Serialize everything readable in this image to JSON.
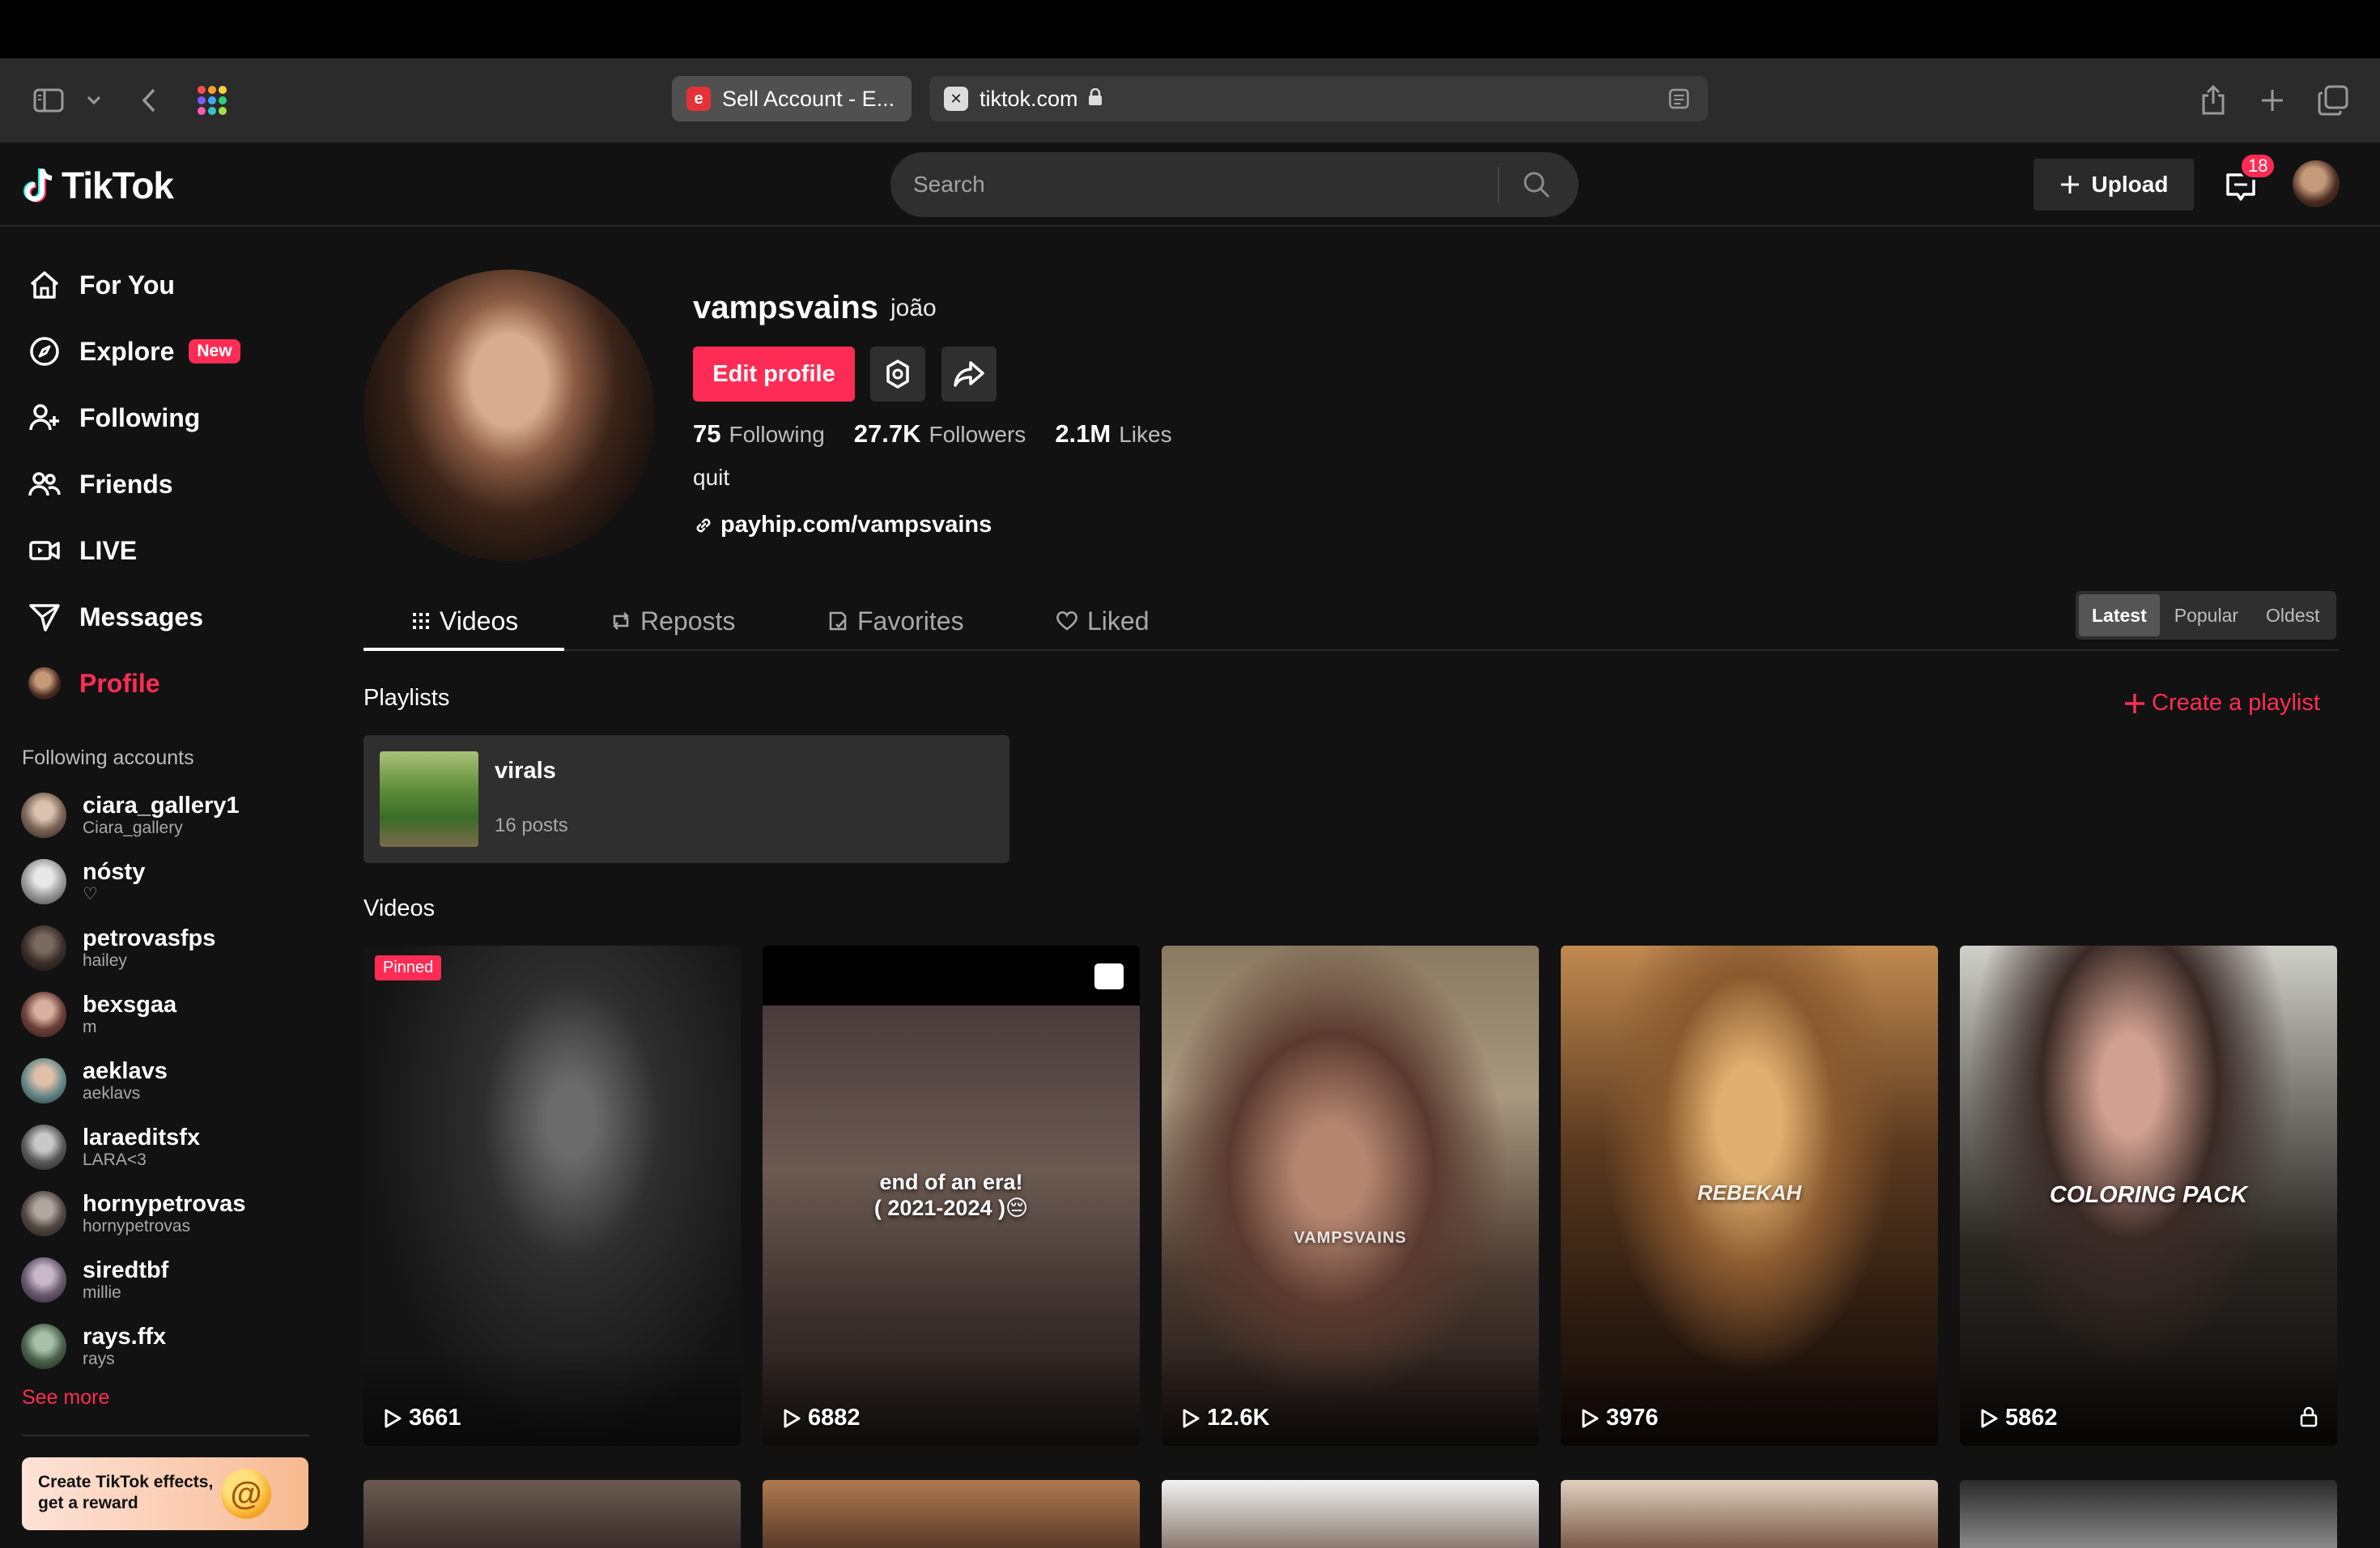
{
  "browser": {
    "tabs": [
      {
        "title": "Sell Account - E...",
        "favicon": "e"
      },
      {
        "title": "tiktok.com",
        "favicon": "x"
      }
    ]
  },
  "header": {
    "logo_text": "TikTok",
    "search_placeholder": "Search",
    "upload_label": "Upload",
    "inbox_count": "18"
  },
  "sidebar": {
    "nav": [
      {
        "label": "For You",
        "icon": "home-icon"
      },
      {
        "label": "Explore",
        "icon": "compass-icon",
        "badge": "New"
      },
      {
        "label": "Following",
        "icon": "user-plus-icon"
      },
      {
        "label": "Friends",
        "icon": "friends-icon"
      },
      {
        "label": "LIVE",
        "icon": "live-icon"
      },
      {
        "label": "Messages",
        "icon": "send-icon"
      },
      {
        "label": "Profile",
        "icon": "avatar-icon"
      }
    ],
    "following_title": "Following accounts",
    "accounts": [
      {
        "name": "ciara_gallery1",
        "sub": "Ciara_gallery"
      },
      {
        "name": "nósty",
        "sub": "♡"
      },
      {
        "name": "petrovasfps",
        "sub": "hailey"
      },
      {
        "name": "bexsgaa",
        "sub": "m"
      },
      {
        "name": "aeklavs",
        "sub": "aeklavs"
      },
      {
        "name": "laraeditsfx",
        "sub": "LARA<3"
      },
      {
        "name": "hornypetrovas",
        "sub": "hornypetrovas"
      },
      {
        "name": "siredtbf",
        "sub": "millie"
      },
      {
        "name": "rays.ffx",
        "sub": "rays"
      }
    ],
    "see_more": "See more",
    "effects_banner": "Create TikTok effects, get a reward"
  },
  "profile": {
    "username": "vampsvains",
    "nickname": "joão",
    "edit_label": "Edit profile",
    "following_count": "75",
    "following_label": "Following",
    "followers_count": "27.7K",
    "followers_label": "Followers",
    "likes_count": "2.1M",
    "likes_label": "Likes",
    "bio": "quit",
    "link": "payhip.com/vampsvains"
  },
  "tabs": [
    "Videos",
    "Reposts",
    "Favorites",
    "Liked"
  ],
  "sort": {
    "options": [
      "Latest",
      "Popular",
      "Oldest"
    ],
    "selected": "Latest"
  },
  "playlists": {
    "title": "Playlists",
    "create_label": "Create a playlist",
    "items": [
      {
        "name": "virals",
        "count": "16 posts"
      }
    ]
  },
  "videos": {
    "title": "Videos",
    "items": [
      {
        "views": "3661",
        "pinned": "Pinned",
        "overlay": ""
      },
      {
        "views": "6882",
        "overlay": "end of an era!\n( 2021-2024 )😔"
      },
      {
        "views": "12.6K",
        "overlay": "VAMPSVAINS"
      },
      {
        "views": "3976",
        "overlay": "REBEKAH"
      },
      {
        "views": "5862",
        "overlay": "COLORING PACK"
      }
    ]
  }
}
